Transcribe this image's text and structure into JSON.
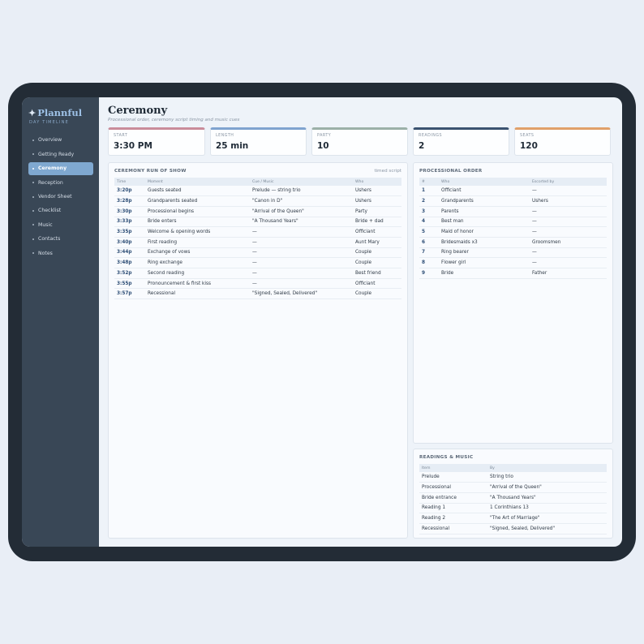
{
  "brand": {
    "icon": "sparkle-icon",
    "glyph": "✦",
    "name": "Plannful",
    "subtitle": "DAY TIMELINE"
  },
  "nav": [
    {
      "label": "Overview",
      "active": false
    },
    {
      "label": "Getting Ready",
      "active": false
    },
    {
      "label": "Ceremony",
      "active": true
    },
    {
      "label": "Reception",
      "active": false
    },
    {
      "label": "Vendor Sheet",
      "active": false
    },
    {
      "label": "Checklist",
      "active": false
    },
    {
      "label": "Music",
      "active": false
    },
    {
      "label": "Contacts",
      "active": false
    },
    {
      "label": "Notes",
      "active": false
    }
  ],
  "page": {
    "title": "Ceremony",
    "subtitle": "Processional order, ceremony script timing and music cues"
  },
  "stats": [
    {
      "label": "START",
      "value": "3:30 PM",
      "color": "#c98c9a"
    },
    {
      "label": "LENGTH",
      "value": "25 min",
      "color": "#7fa3cf"
    },
    {
      "label": "PARTY",
      "value": "10",
      "color": "#9bb0a8"
    },
    {
      "label": "READINGS",
      "value": "2",
      "color": "#3a5270"
    },
    {
      "label": "SEATS",
      "value": "120",
      "color": "#e0a06a"
    }
  ],
  "run_of_show": {
    "title": "CEREMONY RUN OF SHOW",
    "tag": "timed script",
    "columns": [
      "Time",
      "Moment",
      "Cue / Music",
      "Who"
    ],
    "rows": [
      [
        "3:20p",
        "Guests seated",
        "Prelude — string trio",
        "Ushers"
      ],
      [
        "3:28p",
        "Grandparents seated",
        "\"Canon in D\"",
        "Ushers"
      ],
      [
        "3:30p",
        "Processional begins",
        "\"Arrival of the Queen\"",
        "Party"
      ],
      [
        "3:33p",
        "Bride enters",
        "\"A Thousand Years\"",
        "Bride + dad"
      ],
      [
        "3:35p",
        "Welcome & opening words",
        "—",
        "Officiant"
      ],
      [
        "3:40p",
        "First reading",
        "—",
        "Aunt Mary"
      ],
      [
        "3:44p",
        "Exchange of vows",
        "—",
        "Couple"
      ],
      [
        "3:48p",
        "Ring exchange",
        "—",
        "Couple"
      ],
      [
        "3:52p",
        "Second reading",
        "—",
        "Best friend"
      ],
      [
        "3:55p",
        "Pronouncement & first kiss",
        "—",
        "Officiant"
      ],
      [
        "3:57p",
        "Recessional",
        "\"Signed, Sealed, Delivered\"",
        "Couple"
      ]
    ]
  },
  "processional": {
    "title": "PROCESSIONAL ORDER",
    "columns": [
      "#",
      "Who",
      "Escorted by"
    ],
    "rows": [
      [
        "1",
        "Officiant",
        "—"
      ],
      [
        "2",
        "Grandparents",
        "Ushers"
      ],
      [
        "3",
        "Parents",
        "—"
      ],
      [
        "4",
        "Best man",
        "—"
      ],
      [
        "5",
        "Maid of honor",
        "—"
      ],
      [
        "6",
        "Bridesmaids x3",
        "Groomsmen"
      ],
      [
        "7",
        "Ring bearer",
        "—"
      ],
      [
        "8",
        "Flower girl",
        "—"
      ],
      [
        "9",
        "Bride",
        "Father"
      ]
    ]
  },
  "readings_music": {
    "title": "READINGS & MUSIC",
    "columns": [
      "Item",
      "By"
    ],
    "rows": [
      [
        "Prelude",
        "String trio"
      ],
      [
        "Processional",
        "\"Arrival of the Queen\""
      ],
      [
        "Bride entrance",
        "\"A Thousand Years\""
      ],
      [
        "Reading 1",
        "1 Corinthians 13"
      ],
      [
        "Reading 2",
        "\"The Art of Marriage\""
      ],
      [
        "Recessional",
        "\"Signed, Sealed, Delivered\""
      ]
    ]
  }
}
